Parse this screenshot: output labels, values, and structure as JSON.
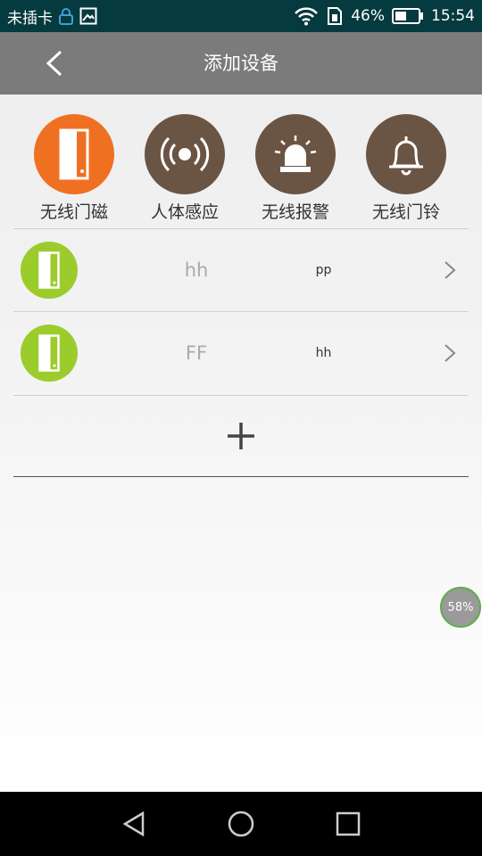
{
  "status_bar": {
    "carrier": "未插卡",
    "battery_percent": "46%",
    "time": "15:54",
    "icons": [
      "lock-icon",
      "image-icon",
      "wifi-icon",
      "sim-icon",
      "battery-icon"
    ]
  },
  "app_bar": {
    "title": "添加设备",
    "back_icon": "chevron-left-icon"
  },
  "device_types": [
    {
      "label": "无线门磁",
      "icon": "door-sensor-icon",
      "color": "#f07022"
    },
    {
      "label": "人体感应",
      "icon": "motion-sensor-icon",
      "color": "#6a5444"
    },
    {
      "label": "无线报警",
      "icon": "alarm-siren-icon",
      "color": "#6a5444"
    },
    {
      "label": "无线门铃",
      "icon": "bell-icon",
      "color": "#6a5444"
    }
  ],
  "devices": [
    {
      "name": "hh",
      "code": "pp",
      "icon": "door-sensor-icon",
      "color": "#9ccc2c"
    },
    {
      "name": "FF",
      "code": "hh",
      "icon": "door-sensor-icon",
      "color": "#9ccc2c"
    }
  ],
  "add_icon": "plus-icon",
  "floating_widget": {
    "label": "58%"
  },
  "nav_bar": {
    "icons": [
      "back-triangle-icon",
      "home-circle-icon",
      "recents-square-icon"
    ]
  }
}
